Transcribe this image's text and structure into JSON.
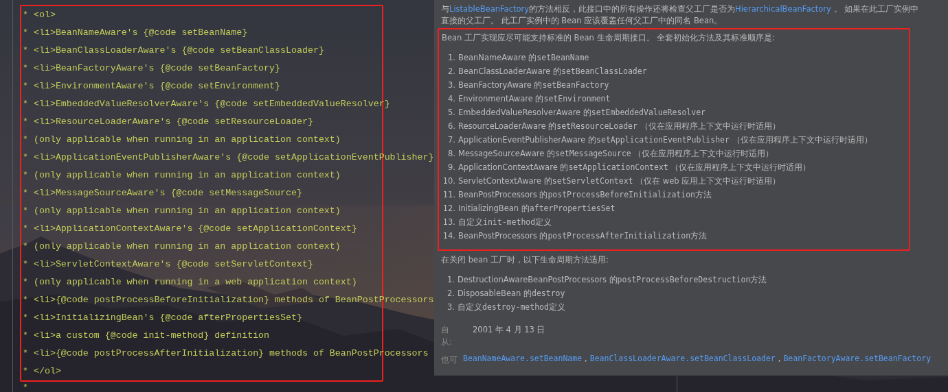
{
  "editor": {
    "lines": [
      "* <ol>",
      "* <li>BeanNameAware's {@code setBeanName}",
      "* <li>BeanClassLoaderAware's {@code setBeanClassLoader}",
      "* <li>BeanFactoryAware's {@code setBeanFactory}",
      "* <li>EnvironmentAware's {@code setEnvironment}",
      "* <li>EmbeddedValueResolverAware's {@code setEmbeddedValueResolver}",
      "* <li>ResourceLoaderAware's {@code setResourceLoader}",
      "* (only applicable when running in an application context)",
      "* <li>ApplicationEventPublisherAware's {@code setApplicationEventPublisher}",
      "* (only applicable when running in an application context)",
      "* <li>MessageSourceAware's {@code setMessageSource}",
      "* (only applicable when running in an application context)",
      "* <li>ApplicationContextAware's {@code setApplicationContext}",
      "* (only applicable when running in an application context)",
      "* <li>ServletContextAware's {@code setServletContext}",
      "* (only applicable when running in a web application context)",
      "* <li>{@code postProcessBeforeInitialization} methods of BeanPostProcessors",
      "* <li>InitializingBean's {@code afterPropertiesSet}",
      "* <li>a custom {@code init-method} definition",
      "* <li>{@code postProcessAfterInitialization} methods of BeanPostProcessors",
      "* </ol>"
    ],
    "trailing_line": "*"
  },
  "doc_popup": {
    "intro": [
      {
        "kind": "text",
        "text": "与"
      },
      {
        "kind": "link",
        "text": "ListableBeanFactory"
      },
      {
        "kind": "text",
        "text": "的方法相反，此接口中的所有操作还将检查父工厂是否为"
      },
      {
        "kind": "link",
        "text": "HierarchicalBeanFactory"
      },
      {
        "kind": "text",
        "text": " 。 如果在此工厂实例中"
      },
      {
        "kind": "break"
      },
      {
        "kind": "text",
        "text": "直接的父工厂。 此工厂实例中的 Bean 应该覆盖任何父工厂中的同名 Bean。"
      }
    ],
    "init_heading": "Bean 工厂实现应尽可能支持标准的 Bean 生命周期接口。 全套初始化方法及其标准顺序是:",
    "init_steps": [
      {
        "number": "1.",
        "parts": [
          {
            "kind": "text",
            "text": "BeanNameAware 的"
          },
          {
            "kind": "code",
            "text": "setBeanName"
          }
        ]
      },
      {
        "number": "2.",
        "parts": [
          {
            "kind": "text",
            "text": "BeanClassLoaderAware 的"
          },
          {
            "kind": "code",
            "text": "setBeanClassLoader"
          }
        ]
      },
      {
        "number": "3.",
        "parts": [
          {
            "kind": "text",
            "text": "BeanFactoryAware 的"
          },
          {
            "kind": "code",
            "text": "setBeanFactory"
          }
        ]
      },
      {
        "number": "4.",
        "parts": [
          {
            "kind": "text",
            "text": "EnvironmentAware 的"
          },
          {
            "kind": "code",
            "text": "setEnvironment"
          }
        ]
      },
      {
        "number": "5.",
        "parts": [
          {
            "kind": "text",
            "text": "EmbeddedValueResolverAware 的"
          },
          {
            "kind": "code",
            "text": "setEmbeddedValueResolver"
          }
        ]
      },
      {
        "number": "6.",
        "parts": [
          {
            "kind": "text",
            "text": "ResourceLoaderAware 的"
          },
          {
            "kind": "code",
            "text": "setResourceLoader"
          },
          {
            "kind": "text",
            "text": " （仅在应用程序上下文中运行时适用）"
          }
        ]
      },
      {
        "number": "7.",
        "parts": [
          {
            "kind": "text",
            "text": "ApplicationEventPublisherAware 的"
          },
          {
            "kind": "code",
            "text": "setApplicationEventPublisher"
          },
          {
            "kind": "text",
            "text": " （仅在应用程序上下文中运行时适用）"
          }
        ]
      },
      {
        "number": "8.",
        "parts": [
          {
            "kind": "text",
            "text": "MessageSourceAware 的"
          },
          {
            "kind": "code",
            "text": "setMessageSource"
          },
          {
            "kind": "text",
            "text": " （仅在应用程序上下文中运行时适用）"
          }
        ]
      },
      {
        "number": "9.",
        "parts": [
          {
            "kind": "text",
            "text": "ApplicationContextAware 的"
          },
          {
            "kind": "code",
            "text": "setApplicationContext"
          },
          {
            "kind": "text",
            "text": " （仅在应用程序上下文中运行时适用）"
          }
        ]
      },
      {
        "number": "10.",
        "parts": [
          {
            "kind": "text",
            "text": "ServletContextAware 的"
          },
          {
            "kind": "code",
            "text": "setServletContext"
          },
          {
            "kind": "text",
            "text": " （仅在 web 应用上下文中运行时适用）"
          }
        ]
      },
      {
        "number": "11.",
        "parts": [
          {
            "kind": "text",
            "text": "BeanPostProcessors 的"
          },
          {
            "kind": "code",
            "text": "postProcessBeforeInitialization"
          },
          {
            "kind": "text",
            "text": "方法"
          }
        ]
      },
      {
        "number": "12.",
        "parts": [
          {
            "kind": "text",
            "text": "InitializingBean 的"
          },
          {
            "kind": "code",
            "text": "afterPropertiesSet"
          }
        ]
      },
      {
        "number": "13.",
        "parts": [
          {
            "kind": "text",
            "text": "自定义"
          },
          {
            "kind": "code",
            "text": "init-method"
          },
          {
            "kind": "text",
            "text": "定义"
          }
        ]
      },
      {
        "number": "14.",
        "parts": [
          {
            "kind": "text",
            "text": "BeanPostProcessors 的"
          },
          {
            "kind": "code",
            "text": "postProcessAfterInitialization"
          },
          {
            "kind": "text",
            "text": "方法"
          }
        ]
      }
    ],
    "shutdown_heading": "在关闭 bean 工厂时，以下生命周期方法适用:",
    "shutdown_steps": [
      {
        "number": "1.",
        "parts": [
          {
            "kind": "text",
            "text": "DestructionAwareBeanPostProcessors 的"
          },
          {
            "kind": "code",
            "text": "postProcessBeforeDestruction"
          },
          {
            "kind": "text",
            "text": "方法"
          }
        ]
      },
      {
        "number": "2.",
        "parts": [
          {
            "kind": "text",
            "text": "DisposableBean 的"
          },
          {
            "kind": "code",
            "text": "destroy"
          }
        ]
      },
      {
        "number": "3.",
        "parts": [
          {
            "kind": "text",
            "text": "自定义"
          },
          {
            "kind": "code",
            "text": "destroy-method"
          },
          {
            "kind": "text",
            "text": "定义"
          }
        ]
      }
    ],
    "since": {
      "label": "自从:",
      "value": "2001 年 4 月 13 日"
    },
    "see_also": {
      "label": "也可",
      "separator": ",",
      "links": [
        "BeanNameAware.setBeanName",
        "BeanClassLoaderAware.setBeanClassLoader",
        "BeanFactoryAware.setBeanFactory"
      ]
    }
  }
}
